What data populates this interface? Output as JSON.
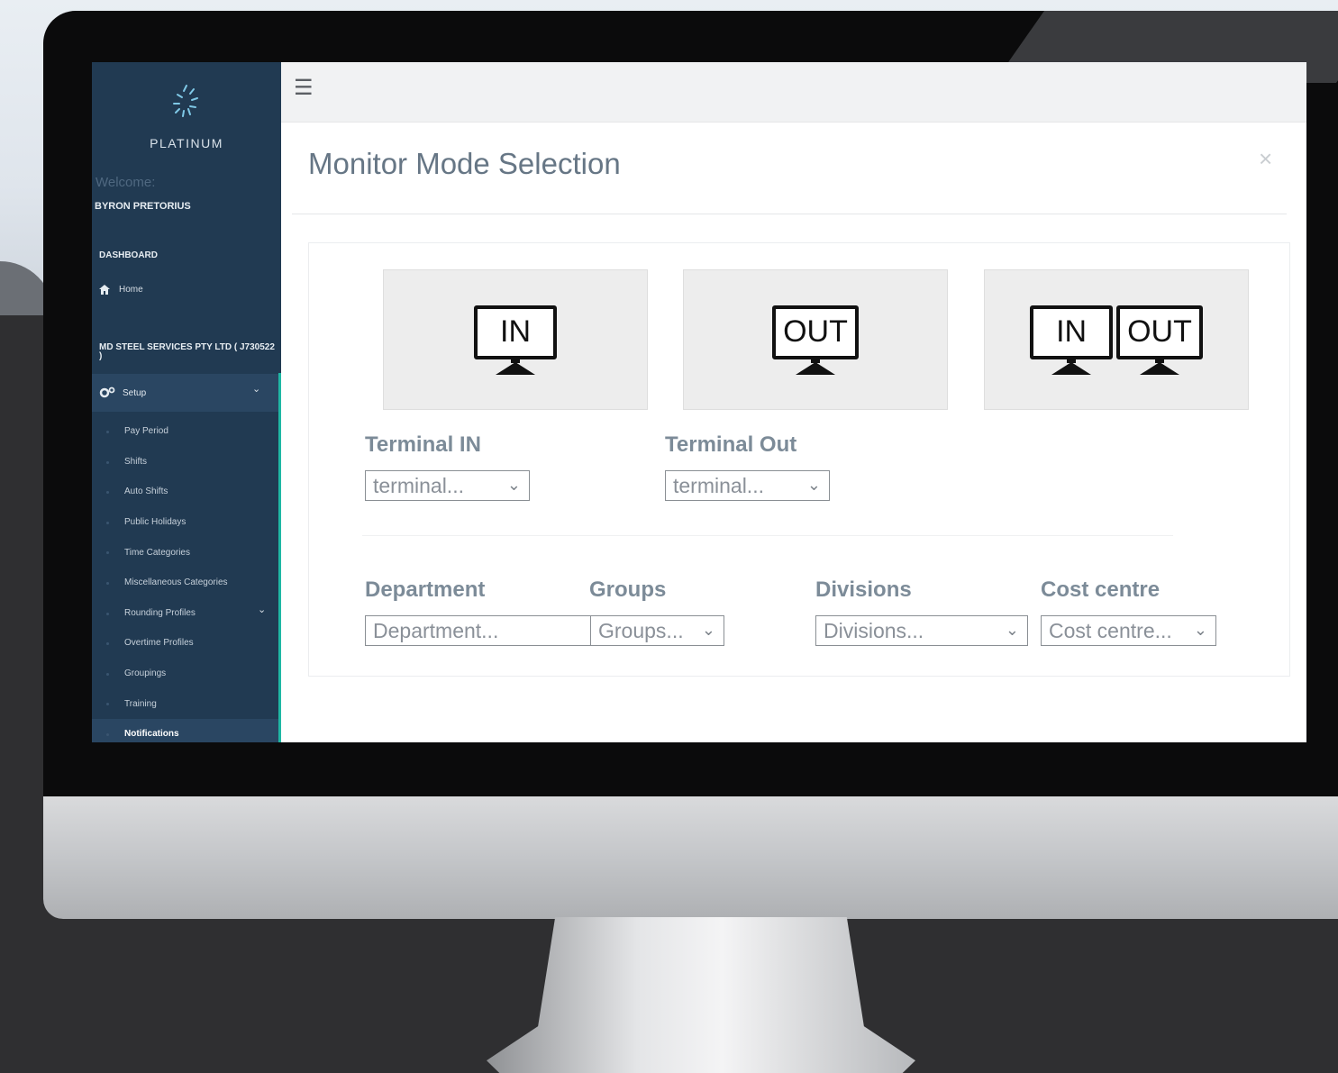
{
  "app": {
    "logo_text": "PLATINUM",
    "welcome": "Welcome:",
    "user_name": "BYRON PRETORIUS"
  },
  "sidebar": {
    "dashboard_label": "DASHBOARD",
    "home_label": "Home",
    "company": "MD STEEL SERVICES PTY LTD ( J730522 )",
    "setup_label": "Setup",
    "items": [
      {
        "label": "Pay Period"
      },
      {
        "label": "Shifts"
      },
      {
        "label": "Auto Shifts"
      },
      {
        "label": "Public Holidays"
      },
      {
        "label": "Time Categories"
      },
      {
        "label": "Miscellaneous Categories"
      },
      {
        "label": "Rounding Profiles"
      },
      {
        "label": "Overtime Profiles"
      },
      {
        "label": "Groupings"
      },
      {
        "label": "Training"
      },
      {
        "label": "Notifications"
      }
    ]
  },
  "modal": {
    "title": "Monitor Mode Selection",
    "close": "×",
    "modes": [
      {
        "screens": [
          "IN"
        ]
      },
      {
        "screens": [
          "OUT"
        ]
      },
      {
        "screens": [
          "IN",
          "OUT"
        ]
      }
    ],
    "terminal_in": {
      "label": "Terminal IN",
      "value": "terminal..."
    },
    "terminal_out": {
      "label": "Terminal Out",
      "value": "terminal..."
    },
    "department": {
      "label": "Department",
      "placeholder": "Department..."
    },
    "groups": {
      "label": "Groups",
      "value": "Groups..."
    },
    "divisions": {
      "label": "Divisions",
      "value": "Divisions..."
    },
    "cost_centre": {
      "label": "Cost centre",
      "value": "Cost centre..."
    }
  },
  "icons": {
    "hamburger": "☰",
    "chevron": "⌄",
    "home": "home-icon",
    "cogs": "cogs-icon"
  },
  "colors": {
    "sidebar_bg": "#213a52",
    "accent": "#1fb7a4",
    "title": "#667685"
  }
}
